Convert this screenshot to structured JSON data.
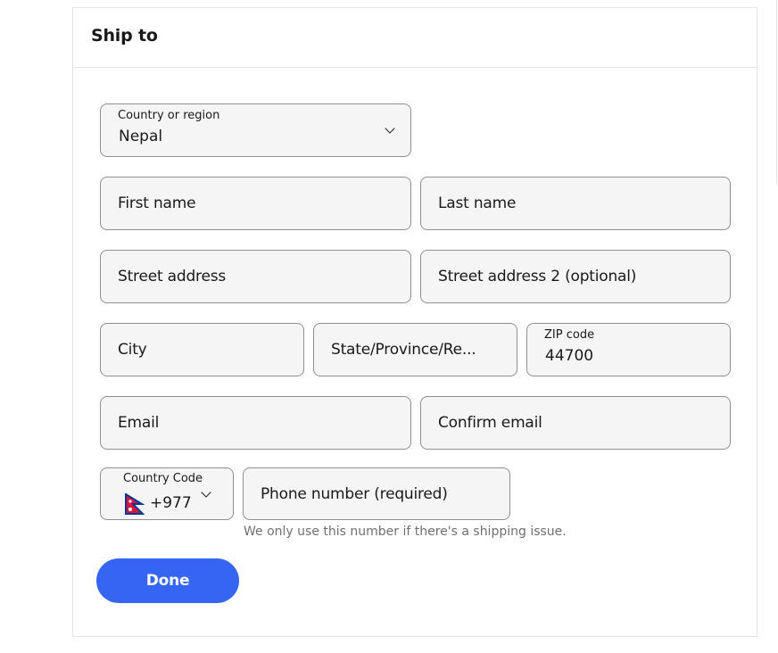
{
  "card": {
    "title": "Ship to"
  },
  "form": {
    "country": {
      "label": "Country or region",
      "value": "Nepal"
    },
    "first_name": {
      "placeholder": "First name"
    },
    "last_name": {
      "placeholder": "Last name"
    },
    "street1": {
      "placeholder": "Street address"
    },
    "street2": {
      "placeholder": "Street address 2 (optional)"
    },
    "city": {
      "placeholder": "City"
    },
    "state": {
      "placeholder": "State/Province/Re..."
    },
    "zip": {
      "label": "ZIP code",
      "value": "44700"
    },
    "email": {
      "placeholder": "Email"
    },
    "confirm_email": {
      "placeholder": "Confirm email"
    },
    "country_code": {
      "label": "Country Code",
      "value": "+977",
      "flag": "nepal-flag-icon"
    },
    "phone": {
      "placeholder": "Phone number (required)",
      "helper": "We only use this number if there's a shipping issue."
    },
    "done_label": "Done"
  },
  "colors": {
    "primary_button": "#3665f3",
    "field_bg": "#f5f5f5",
    "field_border": "#8f8f8f",
    "helper_text": "#707070",
    "divider": "#e5e5e5"
  }
}
